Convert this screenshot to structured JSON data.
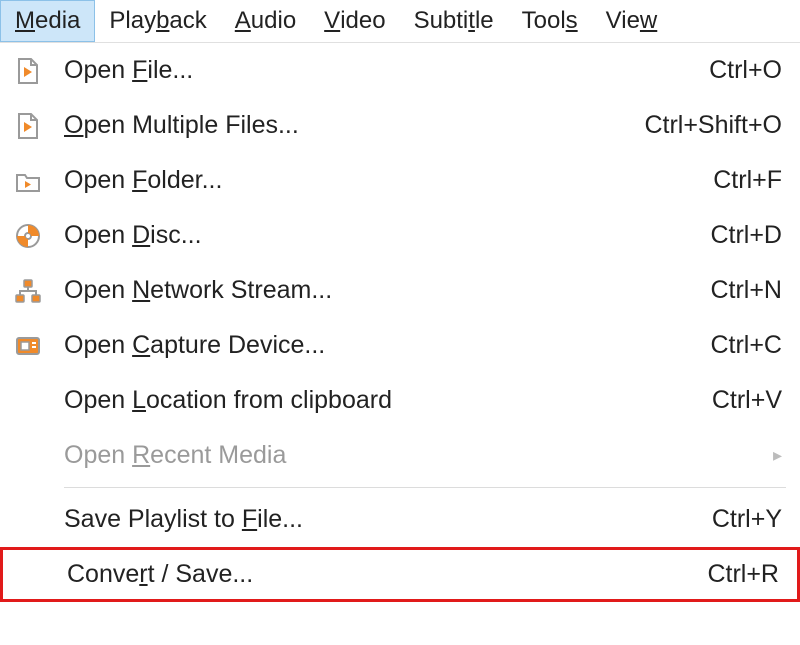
{
  "menubar": {
    "items": [
      {
        "label": "Media",
        "mn_index": 0,
        "active": true
      },
      {
        "label": "Playback",
        "mn_index": 4,
        "active": false
      },
      {
        "label": "Audio",
        "mn_index": 0,
        "active": false
      },
      {
        "label": "Video",
        "mn_index": 0,
        "active": false
      },
      {
        "label": "Subtitle",
        "mn_index": 5,
        "active": false
      },
      {
        "label": "Tools",
        "mn_index": 4,
        "active": false
      },
      {
        "label": "View",
        "mn_index": 3,
        "active": false
      }
    ]
  },
  "dropdown": {
    "items": [
      {
        "label": "Open File...",
        "mn_index": 5,
        "shortcut": "Ctrl+O",
        "icon": "file-play-icon",
        "name": "menu-open-file"
      },
      {
        "label": "Open Multiple Files...",
        "mn_index": 0,
        "shortcut": "Ctrl+Shift+O",
        "icon": "file-play-icon",
        "name": "menu-open-multiple-files"
      },
      {
        "label": "Open Folder...",
        "mn_index": 5,
        "shortcut": "Ctrl+F",
        "icon": "folder-play-icon",
        "name": "menu-open-folder"
      },
      {
        "label": "Open Disc...",
        "mn_index": 5,
        "shortcut": "Ctrl+D",
        "icon": "disc-icon",
        "name": "menu-open-disc"
      },
      {
        "label": "Open Network Stream...",
        "mn_index": 5,
        "shortcut": "Ctrl+N",
        "icon": "network-icon",
        "name": "menu-open-network-stream"
      },
      {
        "label": "Open Capture Device...",
        "mn_index": 5,
        "shortcut": "Ctrl+C",
        "icon": "capture-icon",
        "name": "menu-open-capture-device"
      },
      {
        "label": "Open Location from clipboard",
        "mn_index": 5,
        "shortcut": "Ctrl+V",
        "icon": "",
        "name": "menu-open-location-clipboard"
      },
      {
        "label": "Open Recent Media",
        "mn_index": 5,
        "shortcut": "",
        "icon": "",
        "name": "menu-open-recent-media",
        "disabled": true,
        "submenu": true
      },
      {
        "sep": true
      },
      {
        "label": "Save Playlist to File...",
        "mn_index": 17,
        "shortcut": "Ctrl+Y",
        "icon": "",
        "name": "menu-save-playlist"
      },
      {
        "label": "Convert / Save...",
        "mn_index": 5,
        "shortcut": "Ctrl+R",
        "icon": "",
        "name": "menu-convert-save",
        "highlight": true
      }
    ]
  }
}
